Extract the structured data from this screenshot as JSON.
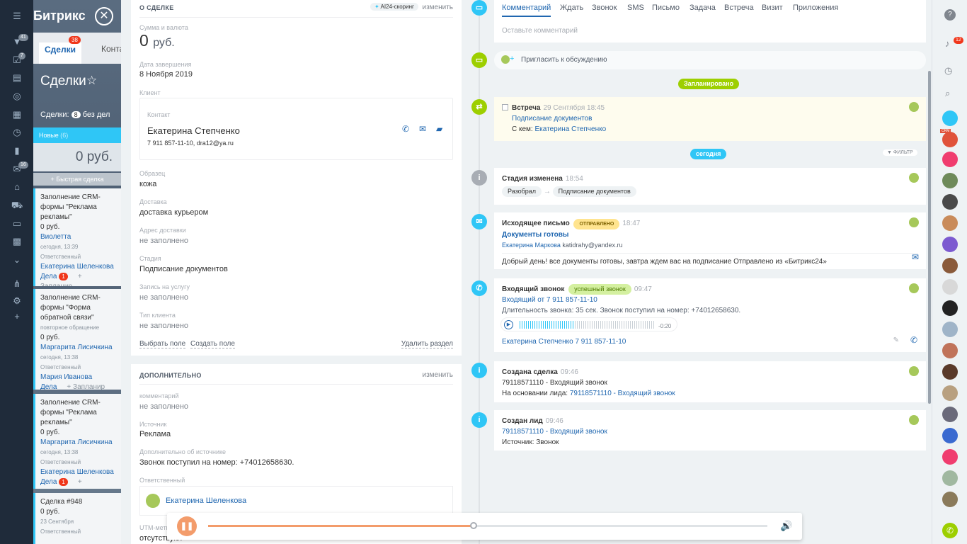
{
  "app": {
    "brand": "Битрикс"
  },
  "under": {
    "tab_deals": "Сделки",
    "tab_deals_badge": "38",
    "tab_contacts": "Конта",
    "title": "Сделки",
    "deals_label": "Сделки:",
    "deals_count": "8",
    "no_deals": "без дел",
    "column_name": "Новые",
    "column_count": "(6)",
    "column_sum": "0 руб.",
    "quick": "+ Быстрая сделка",
    "cards": [
      {
        "title": "Заполнение CRM-формы \"Реклама рекламы\"",
        "sum": "0 руб.",
        "client": "Виолетта",
        "date": "сегодня, 13:39",
        "resp_label": "Ответственный",
        "resp": "Екатерина Шеленкова",
        "dela": "Дела",
        "dela_count": "1",
        "add": "+ Запланир"
      },
      {
        "title": "Заполнение CRM-формы \"Форма обратной связи\"",
        "sub": "повторное обращение",
        "sum": "0 руб.",
        "client": "Маргарита Лисичкина",
        "date": "сегодня, 13:38",
        "resp_label": "Ответственный",
        "resp": "Мария Иванова",
        "dela": "Дела",
        "add": "+ Запланир"
      },
      {
        "title": "Заполнение CRM-формы \"Реклама рекламы\"",
        "sum": "0 руб.",
        "client": "Маргарита Лисичкина",
        "date": "сегодня, 13:38",
        "resp_label": "Ответственный",
        "resp": "Екатерина Шеленкова",
        "dela": "Дела",
        "dela_count": "1",
        "add": "+ Запланир"
      },
      {
        "title": "Сделка #948",
        "sum": "0 руб.",
        "date": "23 Сентября",
        "resp_label": "Ответственный"
      }
    ],
    "leftbar_badges": [
      "41",
      "7",
      "16"
    ]
  },
  "deal": {
    "section_title": "О СДЕЛКЕ",
    "ai_scoring": "AI24-скоринг",
    "edit": "изменить",
    "sum_label": "Сумма и валюта",
    "sum_value": "0",
    "sum_currency": "руб.",
    "close_date_label": "Дата завершения",
    "close_date": "8 Ноября 2019",
    "client_label": "Клиент",
    "contact_label": "Контакт",
    "contact_name": "Екатерина Степченко",
    "contact_info": "7 911 857-11-10, dra12@ya.ru",
    "sample_label": "Образец",
    "sample": "кожа",
    "delivery_label": "Доставка",
    "delivery": "доставка курьером",
    "address_label": "Адрес доставки",
    "address": "не заполнено",
    "stage_label": "Стадия",
    "stage": "Подписание документов",
    "booking_label": "Запись на услугу",
    "booking": "не заполнено",
    "client_type_label": "Тип клиента",
    "client_type": "не заполнено",
    "choose_field": "Выбрать поле",
    "create_field": "Создать поле",
    "delete_section": "Удалить раздел"
  },
  "extra": {
    "section_title": "ДОПОЛНИТЕЛЬНО",
    "edit": "изменить",
    "comment_label": "комментарий",
    "comment": "не заполнено",
    "source_label": "Источник",
    "source": "Реклама",
    "source_more_label": "Дополнительно об источнике",
    "source_more": "Звонок поступил на номер: +74012658630.",
    "resp_label": "Ответственный",
    "resp": "Екатерина Шеленкова",
    "utm_label": "UTM-метки",
    "utm": "отсутствуют"
  },
  "timeline": {
    "tabs": [
      "Комментарий",
      "Ждать",
      "Звонок",
      "SMS",
      "Письмо",
      "Задача",
      "Встреча",
      "Визит",
      "Приложения"
    ],
    "comment_placeholder": "Оставьте комментарий",
    "invite": "Пригласить к обсуждению",
    "planned_label": "Запланировано",
    "today_label": "сегодня",
    "filter": "ФИЛЬТР",
    "meeting": {
      "title": "Встреча",
      "time": "29 Сентября 18:45",
      "subject": "Подписание документов",
      "with_label": "С кем:",
      "with": "Екатерина Степченко"
    },
    "stage_change": {
      "title": "Стадия изменена",
      "time": "18:54",
      "from": "Разобрал",
      "to": "Подписание документов"
    },
    "email": {
      "title": "Исходящее письмо",
      "status": "ОТПРАВЛЕНО",
      "time": "18:47",
      "subject": "Документы готовы",
      "from_name": "Екатерина Маркова",
      "from_email": "katidrahy@yandex.ru",
      "body": "Добрый день! все документы готовы, завтра ждем вас на подписание  Отправлено из «Битрикс24»"
    },
    "call": {
      "title": "Входящий звонок",
      "status": "успешный звонок",
      "time": "09:47",
      "from": "Входящий от 7 911 857-11-10",
      "duration": "Длительность звонка: 35 сек. Звонок поступил на номер: +74012658630.",
      "remaining": "-0:20",
      "contact": "Екатерина Степченко",
      "phone": "7 911 857-11-10"
    },
    "deal_created": {
      "title": "Создана сделка",
      "time": "09:46",
      "name": "79118571110 - Входящий звонок",
      "based_label": "На основании лида:",
      "based": "79118571110 - Входящий звонок"
    },
    "lead_created": {
      "title": "Создан лид",
      "time": "09:46",
      "name": "79118571110 - Входящий звонок",
      "source": "Источник: Звонок"
    }
  },
  "rightcol": {
    "notify_badge": "12",
    "crm_badge": "CRM"
  },
  "player": {
    "progress": 0.475
  },
  "colors": {
    "accent": "#2067b0",
    "timeline_green": "#9dcf00",
    "timeline_blue": "#2fc6f6",
    "timeline_gray": "#a8adb4"
  }
}
